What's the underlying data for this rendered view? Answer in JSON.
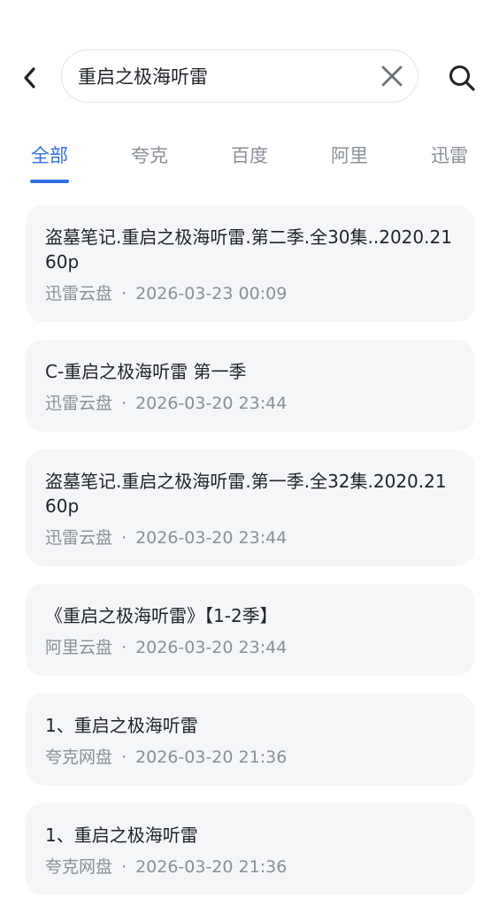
{
  "search": {
    "query": "重启之极海听雷",
    "back_icon": "chevron-left-icon",
    "clear_icon": "close-icon",
    "search_icon": "search-icon"
  },
  "tabs": [
    {
      "label": "全部",
      "active": true
    },
    {
      "label": "夸克",
      "active": false
    },
    {
      "label": "百度",
      "active": false
    },
    {
      "label": "阿里",
      "active": false
    },
    {
      "label": "迅雷",
      "active": false
    }
  ],
  "colors": {
    "accent": "#2f6fe4",
    "card_bg": "#f5f6f8",
    "muted_text": "#8a8f99",
    "primary_text": "#1f2329"
  },
  "results": [
    {
      "title": "盗墓笔记.重启之极海听雷.第二季.全30集..2020.2160p",
      "source": "迅雷云盘",
      "separator": "·",
      "date": "2026-03-23 00:09"
    },
    {
      "title": "C-重启之极海听雷 第一季",
      "source": "迅雷云盘",
      "separator": "·",
      "date": "2026-03-20 23:44"
    },
    {
      "title": "盗墓笔记.重启之极海听雷.第一季.全32集.2020.2160p",
      "source": "迅雷云盘",
      "separator": "·",
      "date": "2026-03-20 23:44"
    },
    {
      "title": "《重启之极海听雷》【1-2季】",
      "source": "阿里云盘",
      "separator": "·",
      "date": "2026-03-20 23:44"
    },
    {
      "title": "1、重启之极海听雷",
      "source": "夸克网盘",
      "separator": "·",
      "date": "2026-03-20 21:36"
    },
    {
      "title": "1、重启之极海听雷",
      "source": "夸克网盘",
      "separator": "·",
      "date": "2026-03-20 21:36"
    }
  ]
}
